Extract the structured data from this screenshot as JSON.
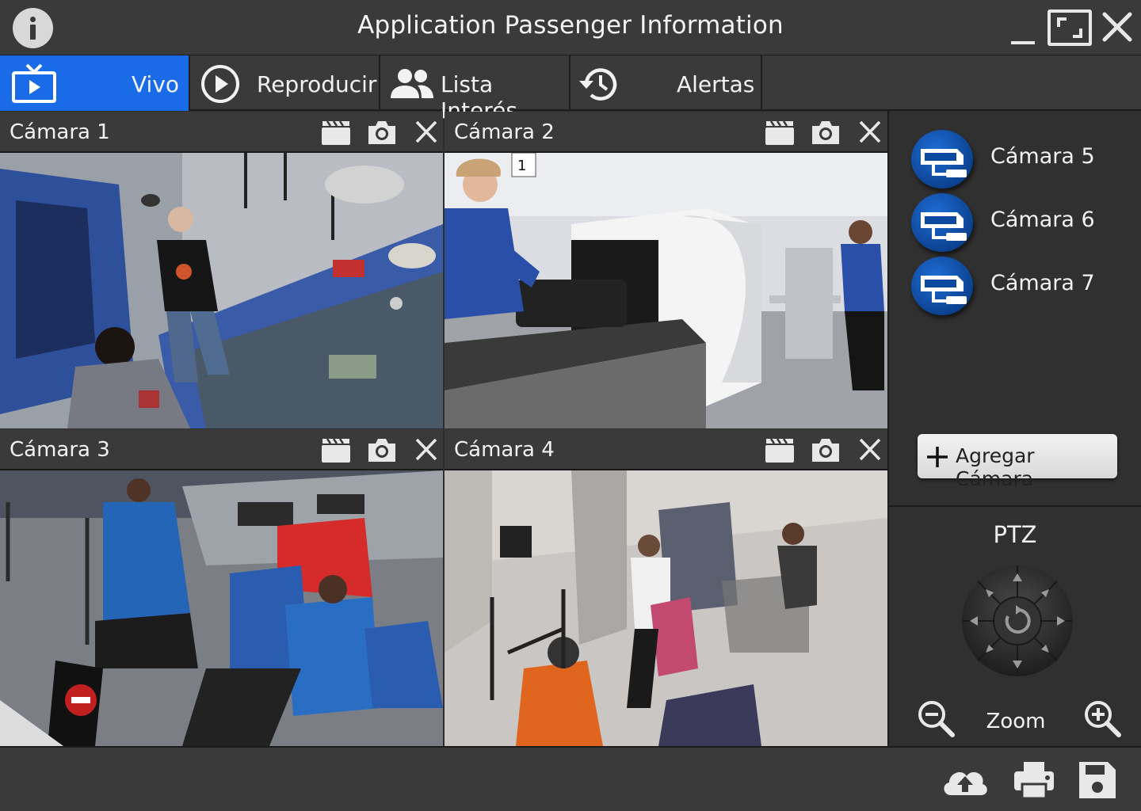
{
  "app": {
    "title": "Application Passenger Information"
  },
  "tabs": [
    {
      "label": "Vivo",
      "icon": "live-tv-icon",
      "active": true
    },
    {
      "label": "Reproducir",
      "icon": "play-icon"
    },
    {
      "label": "Lista Interés",
      "icon": "people-icon"
    },
    {
      "label": "Alertas",
      "icon": "history-icon"
    }
  ],
  "cameras": [
    {
      "title": "Cámara 1",
      "scene": "security-checkpoint-conversation"
    },
    {
      "title": "Cámara 2",
      "scene": "xray-luggage-scanner"
    },
    {
      "title": "Cámara 3",
      "scene": "checkpoint-altercation"
    },
    {
      "title": "Cámara 4",
      "scene": "terminal-hallway-incident"
    }
  ],
  "sidebar": {
    "cameras": [
      {
        "label": "Cámara 5",
        "icon": "cctv-camera-icon"
      },
      {
        "label": "Cámara 6",
        "icon": "cctv-camera-icon"
      },
      {
        "label": "Cámara 7",
        "icon": "cctv-camera-icon"
      }
    ],
    "add_button": "Agregar Cámara"
  },
  "ptz": {
    "title": "PTZ",
    "zoom_label": "Zoom"
  },
  "colors": {
    "accent": "#1a6be8",
    "panel": "#3a3a3a",
    "background": "#2e2e2e",
    "badge": "#0b4a9e"
  }
}
